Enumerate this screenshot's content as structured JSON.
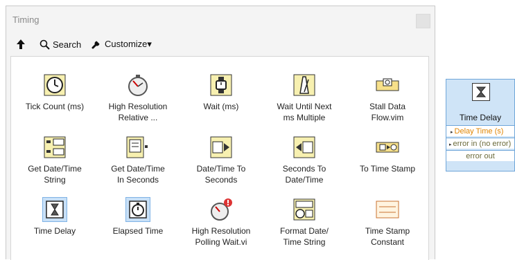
{
  "window": {
    "title": "Timing"
  },
  "toolbar": {
    "up_icon": "up-arrow-icon",
    "search_label": "Search",
    "customize_label": "Customize▾"
  },
  "palette_items": [
    {
      "label": "Tick Count (ms)",
      "icon": "clock-icon"
    },
    {
      "label": "High Resolution\nRelative ...",
      "icon": "stopwatch-icon"
    },
    {
      "label": "Wait (ms)",
      "icon": "wristwatch-icon"
    },
    {
      "label": "Wait Until Next\nms Multiple",
      "icon": "metronome-icon"
    },
    {
      "label": "Stall Data\nFlow.vim",
      "icon": "stall-icon"
    },
    {
      "label": "Get Date/Time\nString",
      "icon": "datetime-string-icon"
    },
    {
      "label": "Get Date/Time\nIn Seconds",
      "icon": "datetime-seconds-icon"
    },
    {
      "label": "Date/Time To\nSeconds",
      "icon": "datetime-to-seconds-icon"
    },
    {
      "label": "Seconds To\nDate/Time",
      "icon": "seconds-to-datetime-icon"
    },
    {
      "label": "To Time Stamp",
      "icon": "timestamp-icon"
    },
    {
      "label": "Time Delay",
      "icon": "hourglass-icon"
    },
    {
      "label": "Elapsed Time",
      "icon": "elapsed-timer-icon"
    },
    {
      "label": "High Resolution\nPolling Wait.vi",
      "icon": "polling-wait-icon"
    },
    {
      "label": "Format Date/\nTime String",
      "icon": "format-datetime-icon"
    },
    {
      "label": "Time Stamp\nConstant",
      "icon": "timestamp-constant-icon"
    }
  ],
  "node": {
    "title": "Time Delay",
    "terminals": [
      "Delay Time (s)",
      "error in (no error)",
      "error out"
    ]
  }
}
